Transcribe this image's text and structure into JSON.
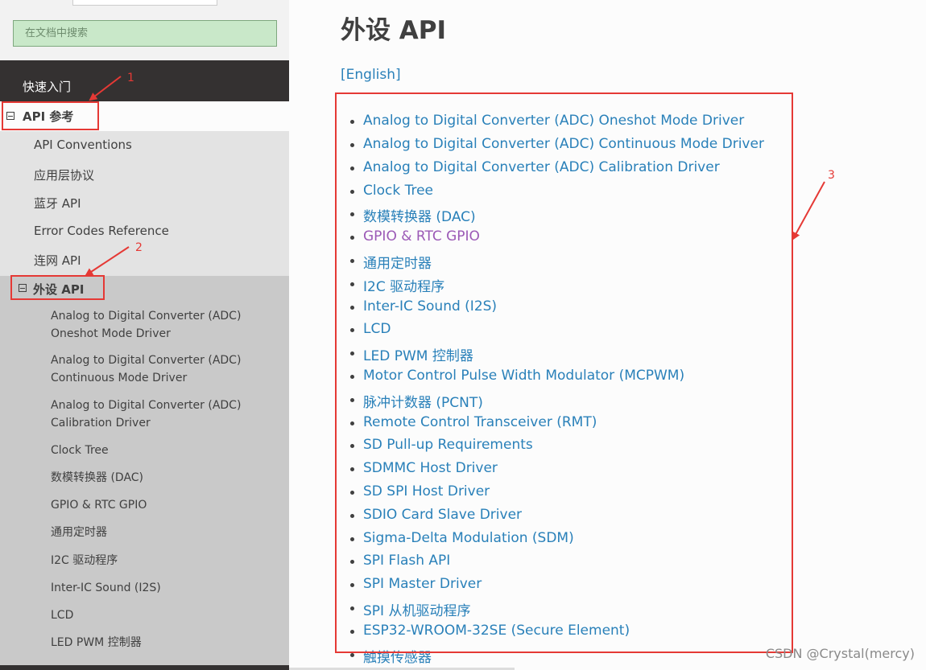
{
  "sidebar": {
    "search_placeholder": "在文档中搜索",
    "nav_quickstart": "快速入门",
    "nav_api_reference": "API 参考",
    "l2_items": [
      "API Conventions",
      "应用层协议",
      "蓝牙 API",
      "Error Codes Reference",
      "连网 API"
    ],
    "l2_current": "外设 API",
    "l3_items": [
      "Analog to Digital Converter (ADC) Oneshot Mode Driver",
      "Analog to Digital Converter (ADC) Continuous Mode Driver",
      "Analog to Digital Converter (ADC) Calibration Driver",
      "Clock Tree",
      "数模转换器 (DAC)",
      "GPIO & RTC GPIO",
      "通用定时器",
      "I2C 驱动程序",
      "Inter-IC Sound (I2S)",
      "LCD",
      "LED PWM 控制器"
    ]
  },
  "main": {
    "title": "外设 API",
    "lang_link": "[English]",
    "toc": [
      "Analog to Digital Converter (ADC) Oneshot Mode Driver",
      "Analog to Digital Converter (ADC) Continuous Mode Driver",
      "Analog to Digital Converter (ADC) Calibration Driver",
      "Clock Tree",
      "数模转换器 (DAC)",
      "GPIO & RTC GPIO",
      "通用定时器",
      "I2C 驱动程序",
      "Inter-IC Sound (I2S)",
      "LCD",
      "LED PWM 控制器",
      "Motor Control Pulse Width Modulator (MCPWM)",
      "脉冲计数器 (PCNT)",
      "Remote Control Transceiver (RMT)",
      "SD Pull-up Requirements",
      "SDMMC Host Driver",
      "SD SPI Host Driver",
      "SDIO Card Slave Driver",
      "Sigma-Delta Modulation (SDM)",
      "SPI Flash API",
      "SPI Master Driver",
      "SPI 从机驱动程序",
      "ESP32-WROOM-32SE (Secure Element)",
      "触摸传感器"
    ],
    "visited_item": "GPIO & RTC GPIO"
  },
  "annotations": {
    "labels": [
      "1",
      "2",
      "3"
    ],
    "color": "#e53935"
  },
  "watermark": "CSDN @Crystal(mercy)",
  "colors": {
    "link": "#2980b9",
    "visited_link": "#9b59b6",
    "sidebar_dark": "#343131",
    "search_bg": "#c9e8c9"
  }
}
